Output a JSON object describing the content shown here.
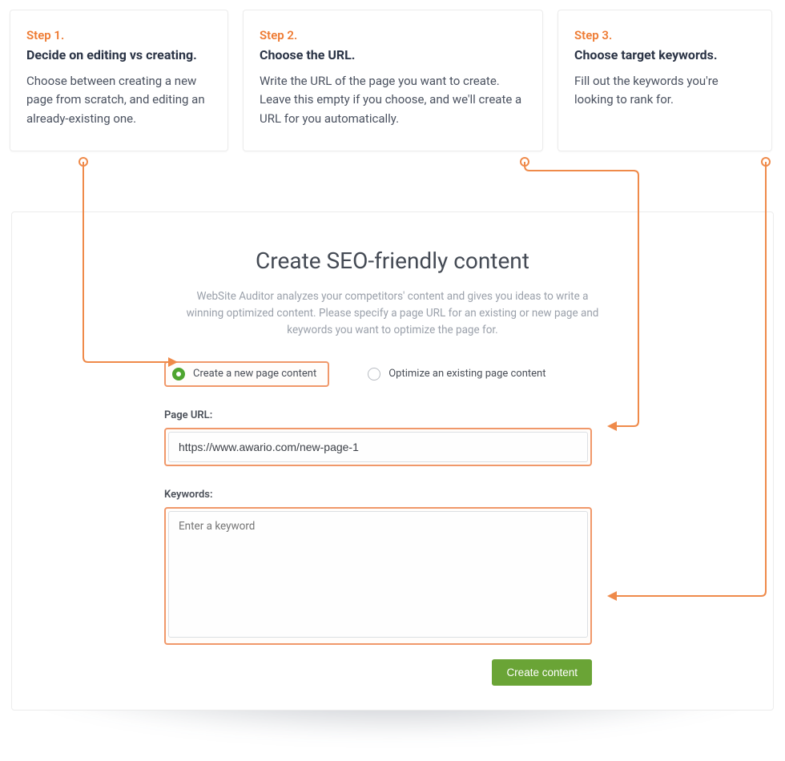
{
  "steps": [
    {
      "num": "Step 1.",
      "title": "Decide on editing vs creating.",
      "desc": "Choose between creating a new page from scratch, and editing an already-existing one."
    },
    {
      "num": "Step 2.",
      "title": "Choose the URL.",
      "desc": "Write the URL of the page you want to create. Leave this empty if you choose, and we'll create a URL for you automatically."
    },
    {
      "num": "Step 3.",
      "title": "Choose target keywords.",
      "desc": "Fill out the keywords you're looking to rank for."
    }
  ],
  "panel": {
    "heading": "Create SEO-friendly content",
    "sub": "WebSite Auditor analyzes your competitors' content and gives you ideas to write a winning optimized content. Please specify a page URL for an existing or new page and keywords you want to optimize the page for."
  },
  "radios": {
    "create": "Create a new page content",
    "optimize": "Optimize an existing page content"
  },
  "form": {
    "url_label": "Page URL:",
    "url_value": "https://www.awario.com/new-page-1",
    "keywords_label": "Keywords:",
    "keywords_placeholder": "Enter a keyword",
    "button": "Create content"
  },
  "colors": {
    "accent_orange": "#ef8a4a",
    "accent_green": "#6aa436"
  }
}
